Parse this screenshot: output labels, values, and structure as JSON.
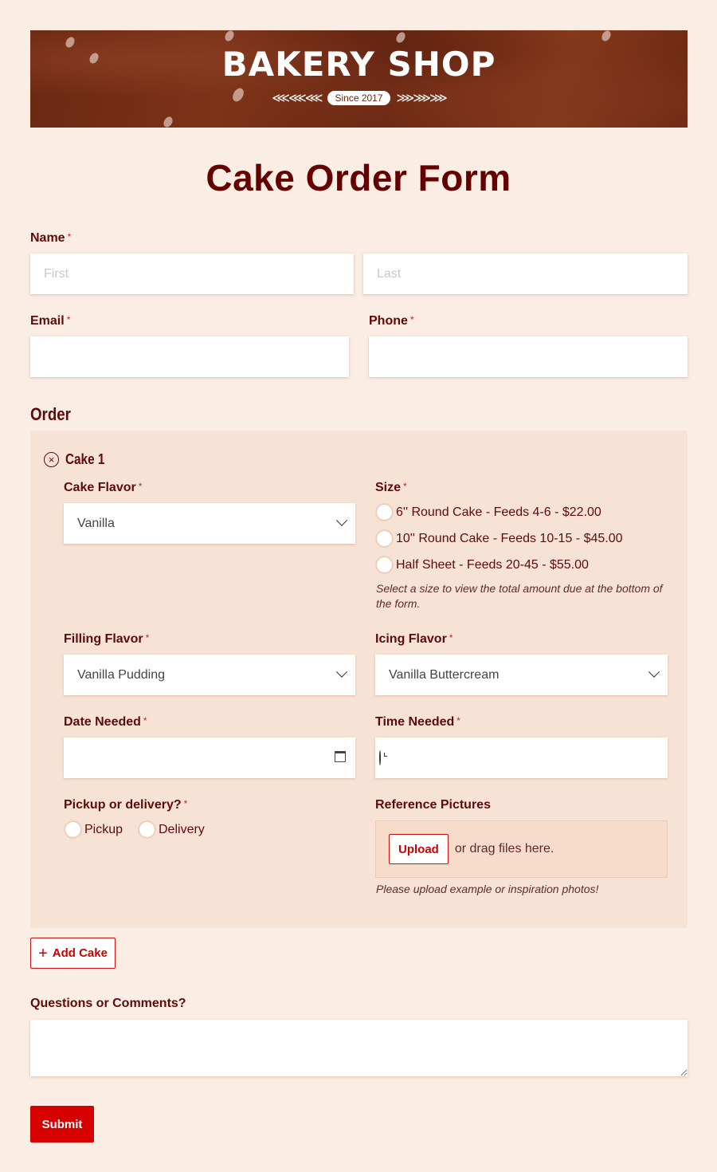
{
  "banner": {
    "title": "BAKERY SHOP",
    "subtitle": "Since 2017",
    "wheat_left": "⋘⋘⋘",
    "wheat_right": "⋙⋙⋙"
  },
  "page_title": "Cake Order Form",
  "required_mark": "*",
  "name": {
    "label": "Name",
    "first_placeholder": "First",
    "last_placeholder": "Last",
    "first_value": "",
    "last_value": ""
  },
  "email": {
    "label": "Email",
    "value": ""
  },
  "phone": {
    "label": "Phone",
    "value": ""
  },
  "order": {
    "section_title": "Order",
    "cake": {
      "title": "Cake 1",
      "remove_icon": "×",
      "flavor": {
        "label": "Cake Flavor",
        "value": "Vanilla"
      },
      "size": {
        "label": "Size",
        "options": [
          "6'' Round Cake - Feeds 4-6 - $22.00",
          "10'' Round Cake - Feeds 10-15 - $45.00",
          "Half Sheet - Feeds 20-45 - $55.00"
        ],
        "selected": null,
        "help": "Select a size to view the total amount due at the bottom of the form."
      },
      "filling": {
        "label": "Filling Flavor",
        "value": "Vanilla Pudding"
      },
      "icing": {
        "label": "Icing Flavor",
        "value": "Vanilla Buttercream"
      },
      "date": {
        "label": "Date Needed",
        "value": ""
      },
      "time": {
        "label": "Time Needed",
        "value": ""
      },
      "pickup": {
        "label": "Pickup or delivery?",
        "options": [
          "Pickup",
          "Delivery"
        ],
        "selected": null
      },
      "reference": {
        "label": "Reference Pictures",
        "upload_label": "Upload",
        "drag_text": "or drag files here.",
        "help": "Please upload example or inspiration photos!"
      }
    },
    "add_label": "Add Cake",
    "add_icon": "+"
  },
  "comments": {
    "label": "Questions or Comments?",
    "value": ""
  },
  "submit_label": "Submit",
  "colors": {
    "background": "#faede3",
    "repeater_bg": "#f7e3d6",
    "heading": "#650000",
    "accent": "#d60000"
  }
}
